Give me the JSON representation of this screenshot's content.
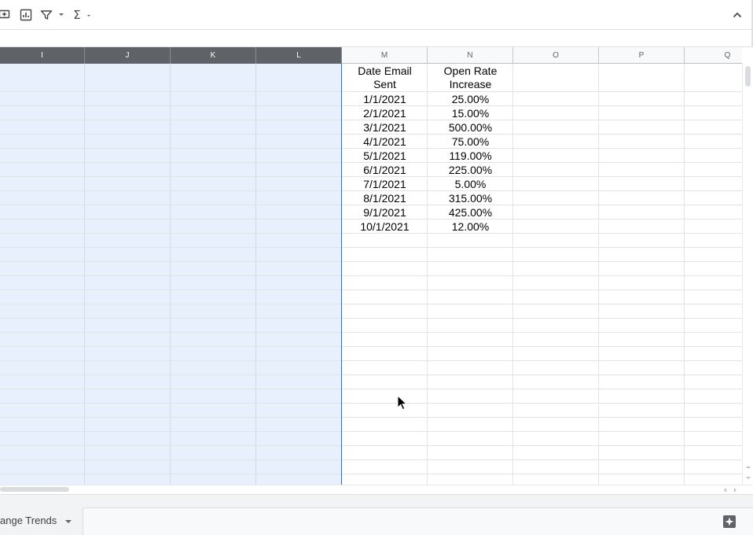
{
  "toolbar": {
    "icons": [
      "insert-comment-icon",
      "insert-chart-icon",
      "filter-icon",
      "functions-icon",
      "collapse-chevron-up-icon"
    ],
    "functions_symbol": "Σ"
  },
  "formula_bar": {
    "value": ""
  },
  "columns": [
    {
      "id": "I",
      "label": "I",
      "selected": true
    },
    {
      "id": "J",
      "label": "J",
      "selected": true
    },
    {
      "id": "K",
      "label": "K",
      "selected": true
    },
    {
      "id": "L",
      "label": "L",
      "selected": true
    },
    {
      "id": "M",
      "label": "M",
      "selected": false
    },
    {
      "id": "N",
      "label": "N",
      "selected": false
    },
    {
      "id": "O",
      "label": "O",
      "selected": false
    },
    {
      "id": "P",
      "label": "P",
      "selected": false
    },
    {
      "id": "Q",
      "label": "Q",
      "selected": false
    }
  ],
  "table": {
    "headers": {
      "M": [
        "Date Email",
        "Sent"
      ],
      "N": [
        "Open Rate",
        "Increase"
      ]
    },
    "rows": [
      {
        "M": "1/1/2021",
        "N": "25.00%"
      },
      {
        "M": "2/1/2021",
        "N": "15.00%"
      },
      {
        "M": "3/1/2021",
        "N": "500.00%"
      },
      {
        "M": "4/1/2021",
        "N": "75.00%"
      },
      {
        "M": "5/1/2021",
        "N": "119.00%"
      },
      {
        "M": "6/1/2021",
        "N": "225.00%"
      },
      {
        "M": "7/1/2021",
        "N": "5.00%"
      },
      {
        "M": "8/1/2021",
        "N": "315.00%"
      },
      {
        "M": "9/1/2021",
        "N": "425.00%"
      },
      {
        "M": "10/1/2021",
        "N": "12.00%"
      }
    ]
  },
  "sheet_tab": {
    "label": "ange Trends"
  },
  "colors": {
    "selection_fill": "#e8f0fe",
    "selection_border": "#1a73e8",
    "selected_header": "#5f6368"
  }
}
